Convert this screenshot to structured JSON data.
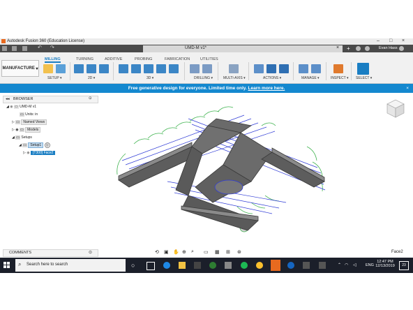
{
  "window": {
    "title": "Autodesk Fusion 360 (Education License)"
  },
  "document": {
    "tab_name": "UMD-M v1*",
    "user": "Evan Hass"
  },
  "ribbon": {
    "workspace": "MANUFACTURE",
    "tabs": [
      "MILLING",
      "TURNING",
      "ADDITIVE",
      "PROBING",
      "FABRICATION",
      "UTILITIES"
    ],
    "groups": [
      "SETUP",
      "2D",
      "3D",
      "DRILLING",
      "MULTI-AXIS",
      "ACTIONS",
      "MANAGE",
      "INSPECT",
      "SELECT"
    ]
  },
  "banner": {
    "text": "Free generative design for everyone. Limited time only.",
    "link": "Learn more here."
  },
  "browser": {
    "title": "BROWSER",
    "items": [
      "UMD-M v1",
      "Units: in",
      "Named Views",
      "Models",
      "Setups",
      "Setup1",
      "[T300] Face2"
    ]
  },
  "comments": {
    "label": "COMMENTS"
  },
  "status": {
    "selection": "Face2"
  },
  "taskbar": {
    "search_placeholder": "Search here to search",
    "lang": "ENG",
    "time": "12:47 PM",
    "date": "12/13/2019",
    "notif_count": "23"
  },
  "colors": {
    "accent": "#1488cf",
    "toolpath": "#2f3bd6",
    "toolpath_link": "#3fb34f",
    "part": "#6e6e6e"
  }
}
